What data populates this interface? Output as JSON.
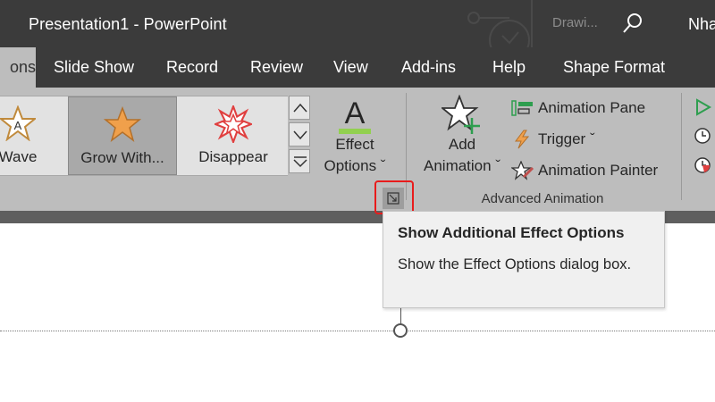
{
  "window": {
    "title": "Presentation1  -  PowerPoint",
    "search_hint": "Drawi...",
    "user": "Nha"
  },
  "tabs": [
    {
      "label": "ons",
      "active": true
    },
    {
      "label": "Slide Show"
    },
    {
      "label": "Record"
    },
    {
      "label": "Review"
    },
    {
      "label": "View"
    },
    {
      "label": "Add-ins"
    },
    {
      "label": "Help"
    },
    {
      "label": "Shape Format"
    }
  ],
  "gallery": {
    "items": [
      {
        "label": "Wave"
      },
      {
        "label": "Grow With...",
        "selected": true
      },
      {
        "label": "Disappear"
      }
    ]
  },
  "effect_options": {
    "line1": "Effect",
    "line2": "Options ˇ",
    "icon_letter": "A"
  },
  "add_animation": {
    "line1": "Add",
    "line2": "Animation ˇ"
  },
  "advanced": {
    "animation_pane": "Animation Pane",
    "trigger": "Trigger ˇ",
    "animation_painter": "Animation Painter",
    "group_label": "Advanced Animation"
  },
  "tooltip": {
    "title": "Show Additional Effect Options",
    "body": "Show the Effect Options dialog box."
  },
  "colors": {
    "titlebar": "#3b3b3b",
    "ribbon": "#bdbdbd",
    "highlight": "#e81c1c",
    "effect_underline": "#92d050",
    "grow_star": "#f0a04b",
    "disappear_star": "#e04040",
    "add_plus": "#2e9e4f"
  }
}
